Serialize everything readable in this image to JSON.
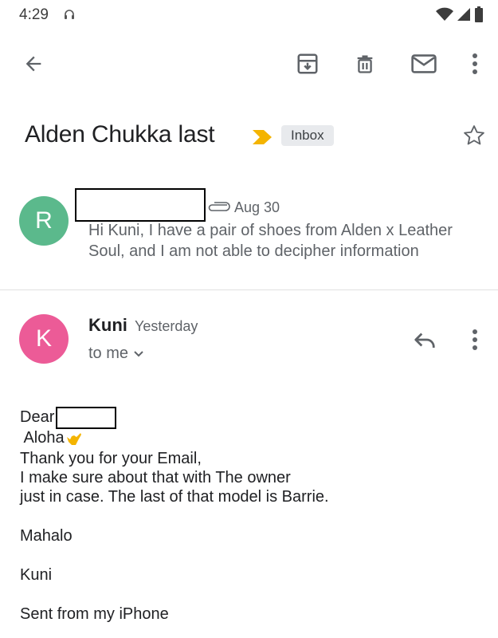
{
  "status_bar": {
    "time": "4:29",
    "icons": [
      "headset-icon",
      "wifi-icon",
      "signal-icon",
      "battery-icon"
    ]
  },
  "toolbar": {
    "icons": [
      "back-arrow-icon",
      "archive-icon",
      "delete-icon",
      "mail-icon",
      "more-vert-icon"
    ]
  },
  "subject": {
    "text": "Alden Chukka last",
    "label": "Inbox",
    "importance_color": "#f4b400"
  },
  "collapsed_message": {
    "avatar_letter": "R",
    "avatar_color": "#5bb98c",
    "date": "Aug 30",
    "preview_line1": "Hi Kuni, I have a pair of shoes from Alden x Leather",
    "preview_line2": "Soul, and I am not able to decipher information"
  },
  "expanded_message": {
    "avatar_letter": "K",
    "avatar_color": "#ec5b97",
    "sender": "Kuni",
    "time": "Yesterday",
    "recipient": "to me",
    "body": {
      "greeting": "Dear",
      "aloha": " Aloha",
      "line1": "Thank you for your Email,",
      "line2": "I make sure about that with The owner",
      "line3": "just in case. The last of that model is Barrie.",
      "signoff": "Mahalo",
      "signature": "Kuni",
      "footer": "Sent from my iPhone"
    }
  }
}
